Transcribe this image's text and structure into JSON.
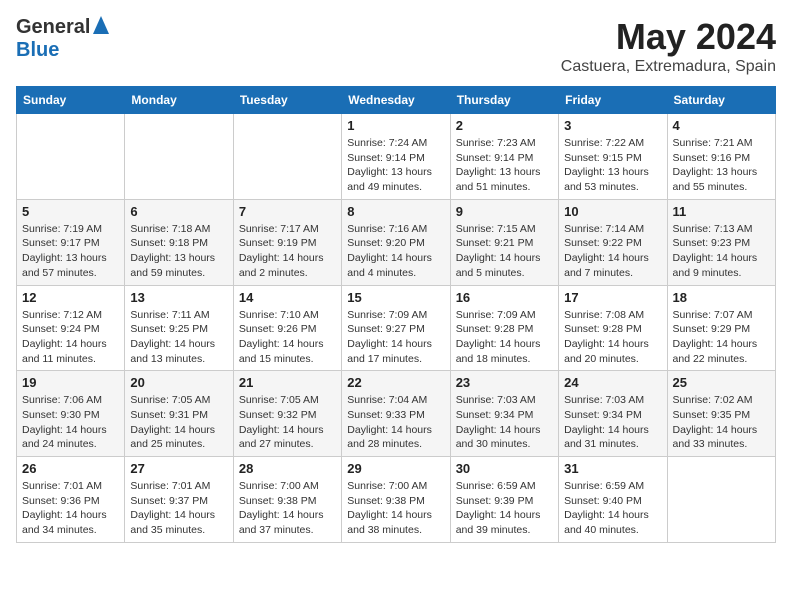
{
  "header": {
    "logo_general": "General",
    "logo_blue": "Blue",
    "title": "May 2024",
    "location": "Castuera, Extremadura, Spain"
  },
  "days_of_week": [
    "Sunday",
    "Monday",
    "Tuesday",
    "Wednesday",
    "Thursday",
    "Friday",
    "Saturday"
  ],
  "weeks": [
    [
      {
        "day": "",
        "info": ""
      },
      {
        "day": "",
        "info": ""
      },
      {
        "day": "",
        "info": ""
      },
      {
        "day": "1",
        "info": "Sunrise: 7:24 AM\nSunset: 9:14 PM\nDaylight: 13 hours\nand 49 minutes."
      },
      {
        "day": "2",
        "info": "Sunrise: 7:23 AM\nSunset: 9:14 PM\nDaylight: 13 hours\nand 51 minutes."
      },
      {
        "day": "3",
        "info": "Sunrise: 7:22 AM\nSunset: 9:15 PM\nDaylight: 13 hours\nand 53 minutes."
      },
      {
        "day": "4",
        "info": "Sunrise: 7:21 AM\nSunset: 9:16 PM\nDaylight: 13 hours\nand 55 minutes."
      }
    ],
    [
      {
        "day": "5",
        "info": "Sunrise: 7:19 AM\nSunset: 9:17 PM\nDaylight: 13 hours\nand 57 minutes."
      },
      {
        "day": "6",
        "info": "Sunrise: 7:18 AM\nSunset: 9:18 PM\nDaylight: 13 hours\nand 59 minutes."
      },
      {
        "day": "7",
        "info": "Sunrise: 7:17 AM\nSunset: 9:19 PM\nDaylight: 14 hours\nand 2 minutes."
      },
      {
        "day": "8",
        "info": "Sunrise: 7:16 AM\nSunset: 9:20 PM\nDaylight: 14 hours\nand 4 minutes."
      },
      {
        "day": "9",
        "info": "Sunrise: 7:15 AM\nSunset: 9:21 PM\nDaylight: 14 hours\nand 5 minutes."
      },
      {
        "day": "10",
        "info": "Sunrise: 7:14 AM\nSunset: 9:22 PM\nDaylight: 14 hours\nand 7 minutes."
      },
      {
        "day": "11",
        "info": "Sunrise: 7:13 AM\nSunset: 9:23 PM\nDaylight: 14 hours\nand 9 minutes."
      }
    ],
    [
      {
        "day": "12",
        "info": "Sunrise: 7:12 AM\nSunset: 9:24 PM\nDaylight: 14 hours\nand 11 minutes."
      },
      {
        "day": "13",
        "info": "Sunrise: 7:11 AM\nSunset: 9:25 PM\nDaylight: 14 hours\nand 13 minutes."
      },
      {
        "day": "14",
        "info": "Sunrise: 7:10 AM\nSunset: 9:26 PM\nDaylight: 14 hours\nand 15 minutes."
      },
      {
        "day": "15",
        "info": "Sunrise: 7:09 AM\nSunset: 9:27 PM\nDaylight: 14 hours\nand 17 minutes."
      },
      {
        "day": "16",
        "info": "Sunrise: 7:09 AM\nSunset: 9:28 PM\nDaylight: 14 hours\nand 18 minutes."
      },
      {
        "day": "17",
        "info": "Sunrise: 7:08 AM\nSunset: 9:28 PM\nDaylight: 14 hours\nand 20 minutes."
      },
      {
        "day": "18",
        "info": "Sunrise: 7:07 AM\nSunset: 9:29 PM\nDaylight: 14 hours\nand 22 minutes."
      }
    ],
    [
      {
        "day": "19",
        "info": "Sunrise: 7:06 AM\nSunset: 9:30 PM\nDaylight: 14 hours\nand 24 minutes."
      },
      {
        "day": "20",
        "info": "Sunrise: 7:05 AM\nSunset: 9:31 PM\nDaylight: 14 hours\nand 25 minutes."
      },
      {
        "day": "21",
        "info": "Sunrise: 7:05 AM\nSunset: 9:32 PM\nDaylight: 14 hours\nand 27 minutes."
      },
      {
        "day": "22",
        "info": "Sunrise: 7:04 AM\nSunset: 9:33 PM\nDaylight: 14 hours\nand 28 minutes."
      },
      {
        "day": "23",
        "info": "Sunrise: 7:03 AM\nSunset: 9:34 PM\nDaylight: 14 hours\nand 30 minutes."
      },
      {
        "day": "24",
        "info": "Sunrise: 7:03 AM\nSunset: 9:34 PM\nDaylight: 14 hours\nand 31 minutes."
      },
      {
        "day": "25",
        "info": "Sunrise: 7:02 AM\nSunset: 9:35 PM\nDaylight: 14 hours\nand 33 minutes."
      }
    ],
    [
      {
        "day": "26",
        "info": "Sunrise: 7:01 AM\nSunset: 9:36 PM\nDaylight: 14 hours\nand 34 minutes."
      },
      {
        "day": "27",
        "info": "Sunrise: 7:01 AM\nSunset: 9:37 PM\nDaylight: 14 hours\nand 35 minutes."
      },
      {
        "day": "28",
        "info": "Sunrise: 7:00 AM\nSunset: 9:38 PM\nDaylight: 14 hours\nand 37 minutes."
      },
      {
        "day": "29",
        "info": "Sunrise: 7:00 AM\nSunset: 9:38 PM\nDaylight: 14 hours\nand 38 minutes."
      },
      {
        "day": "30",
        "info": "Sunrise: 6:59 AM\nSunset: 9:39 PM\nDaylight: 14 hours\nand 39 minutes."
      },
      {
        "day": "31",
        "info": "Sunrise: 6:59 AM\nSunset: 9:40 PM\nDaylight: 14 hours\nand 40 minutes."
      },
      {
        "day": "",
        "info": ""
      }
    ]
  ]
}
